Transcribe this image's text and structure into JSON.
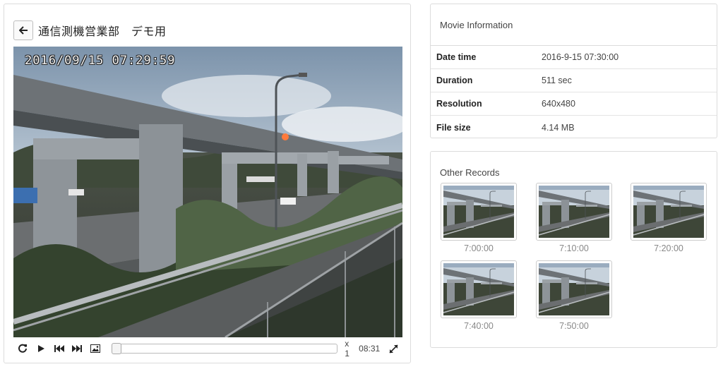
{
  "header": {
    "back_icon": "arrow-left-icon",
    "title": "通信測機営業部　デモ用"
  },
  "video": {
    "osd_timestamp": "2016/09/15  07:29:59",
    "controls": {
      "replay_icon": "replay-icon",
      "play_icon": "play-icon",
      "prev_icon": "skip-previous-icon",
      "next_icon": "skip-next-icon",
      "snapshot_icon": "image-icon",
      "fullscreen_icon": "expand-icon",
      "progress": 0.0,
      "speed": "x 1",
      "duration": "08:31"
    }
  },
  "movie_info": {
    "heading": "Movie Information",
    "rows": [
      {
        "label": "Date time",
        "value": "2016-9-15 07:30:00"
      },
      {
        "label": "Duration",
        "value": "511 sec"
      },
      {
        "label": "Resolution",
        "value": "640x480"
      },
      {
        "label": "File size",
        "value": "4.14 MB"
      }
    ]
  },
  "other_records": {
    "heading": "Other Records",
    "items": [
      {
        "time": "7:00:00"
      },
      {
        "time": "7:10:00"
      },
      {
        "time": "7:20:00"
      },
      {
        "time": "7:40:00"
      },
      {
        "time": "7:50:00"
      }
    ]
  }
}
